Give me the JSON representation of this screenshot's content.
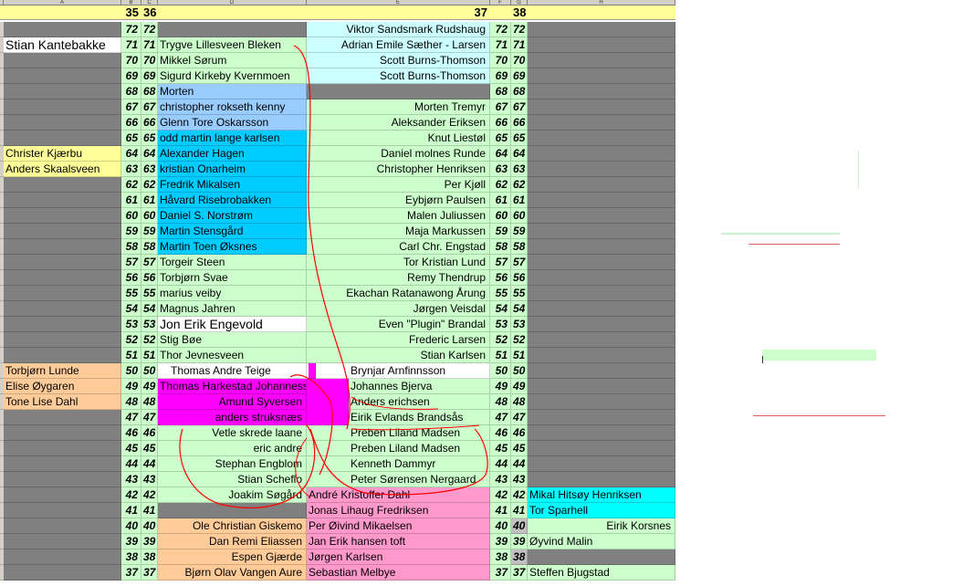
{
  "column_letters": [
    "A",
    "B",
    "C",
    "D",
    "E",
    "F",
    "G",
    "H"
  ],
  "week_headers": {
    "w35": "35",
    "w36": "36",
    "w37": "37",
    "w38": "38"
  },
  "rank_numbers": [
    "72",
    "71",
    "70",
    "69",
    "68",
    "67",
    "66",
    "65",
    "64",
    "63",
    "62",
    "61",
    "60",
    "59",
    "58",
    "57",
    "56",
    "55",
    "54",
    "53",
    "52",
    "51",
    "50",
    "49",
    "48",
    "47",
    "46",
    "45",
    "44",
    "43",
    "42",
    "41",
    "40",
    "39",
    "38",
    "37"
  ],
  "col_a": {
    "71": "Stian Kantebakke",
    "64": "Christer Kjærbu",
    "63": "Anders Skaalsveen",
    "50": "Torbjørn Lunde",
    "49": "Elise Øygaren",
    "48": "Tone Lise Dahl"
  },
  "col_d": {
    "71": "Trygve Lillesveen Bleken",
    "70": "Mikkel Sørum",
    "69": "Sigurd Kirkeby Kvernmoen",
    "68": "Morten",
    "67": "christopher rokseth kenny",
    "66": "Glenn Tore Oskarsson",
    "65": "odd martin lange karlsen",
    "64": "Alexander Hagen",
    "63": "kristian Onarheim",
    "62": "Fredrik Mikalsen",
    "61": "Håvard Risebrobakken",
    "60": "Daniel S. Norstrøm",
    "59": "Martin Stensgård",
    "58": "Martin Toen Øksnes",
    "57": "Torgeir Steen",
    "56": "Torbjørn Svae",
    "55": "marius veiby",
    "54": "Magnus Jahren",
    "53": "Jon Erik Engevold",
    "52": "Stig Bøe",
    "51": "Thor Jevnesveen",
    "50": "Thomas Andre Teige",
    "49": "Thomas Harkestad Johannessen",
    "48": "Amund Syversen",
    "47": "anders struksnæs",
    "46": "Vetle skrede laane",
    "45": "eric andre",
    "44": "Stephan Engblom",
    "43": "Stian Scheflo",
    "42": "Joakim Søgård",
    "40": "Ole Christian Giskemo",
    "39": "Dan Remi Eliassen",
    "38": "Espen Gjærde",
    "37": "Bjørn Olav Vangen Aure"
  },
  "col_e": {
    "72": "Viktor Sandsmark Rudshaug",
    "71": "Adrian Emile Sæther - Larsen",
    "70": "Scott Burns-Thomson",
    "69": "Scott Burns-Thomson",
    "67": "Morten Tremyr",
    "66": "Aleksander Eriksen",
    "65": "Knut Liestøl",
    "64": "Daniel molnes Runde",
    "63": "Christopher Henriksen",
    "62": "Per Kjøll",
    "61": "Eybjørn Paulsen",
    "60": "Malen Juliussen",
    "59": "Maja Markussen",
    "58": "Carl Chr. Engstad",
    "57": "Tor Kristian Lund",
    "56": "Remy Thendrup",
    "55": "Ekachan Ratanawong Årung",
    "54": "Jørgen Veisdal",
    "53": "Even \"Plugin\" Brandal",
    "52": "Frederic Larsen",
    "51": "Stian Karlsen",
    "50": "Brynjar Arnfinnsson",
    "49": "Johannes Bjerva",
    "48": "Anders erichsen",
    "47": "Eirik Evlands Brandsås",
    "46": "Preben Liland Madsen",
    "45": "Preben Liland Madsen",
    "44": "Kenneth Dammyr",
    "43": "Peter Sørensen Nergaard",
    "42": "André Kristoffer Dahl",
    "41": "Jonas Lihaug Fredriksen",
    "40": "Per Øivind Mikaelsen",
    "39": "Jan Erik hansen toft",
    "38": "Jørgen Karlsen",
    "37": "Sebastian Melbye"
  },
  "col_h": {
    "42": "Mikal Hitsøy Henriksen",
    "41": "Tor Sparhell",
    "40": "Eirik Korsnes",
    "39": "Øyvind Malin",
    "37": "Steffen Bjugstad"
  },
  "colors": {
    "gray": "#808080",
    "light_green": "#ccffcc",
    "light_blue": "#99ccff",
    "cyan": "#00ccff",
    "cyan_bright": "#00ffff",
    "light_cyan": "#ccffff",
    "light_yellow": "#ffff99",
    "tan": "#ffcc99",
    "magenta": "#ff00ff",
    "pink": "#ff99cc",
    "annotation_red": "#ff0000"
  }
}
